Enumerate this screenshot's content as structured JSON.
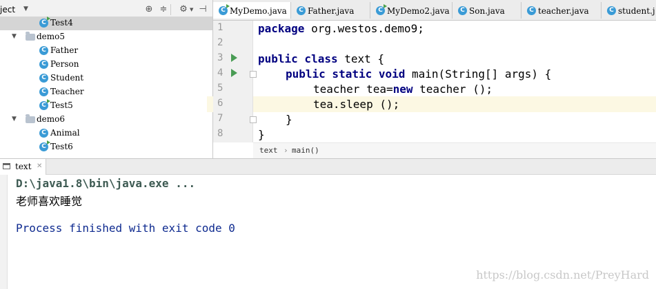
{
  "project_panel": {
    "title": "ject",
    "tree": [
      {
        "label": "Test4",
        "type": "class-run",
        "selected": true
      },
      {
        "label": "demo5",
        "type": "package"
      },
      {
        "label": "Father",
        "type": "class"
      },
      {
        "label": "Person",
        "type": "class"
      },
      {
        "label": "Student",
        "type": "class"
      },
      {
        "label": "Teacher",
        "type": "class"
      },
      {
        "label": "Test5",
        "type": "class-run"
      },
      {
        "label": "demo6",
        "type": "package"
      },
      {
        "label": "Animal",
        "type": "class"
      },
      {
        "label": "Test6",
        "type": "class-run"
      }
    ]
  },
  "editor": {
    "tabs": [
      {
        "label": "MyDemo.java"
      },
      {
        "label": "Father.java"
      },
      {
        "label": "MyDemo2.java"
      },
      {
        "label": "Son.java"
      },
      {
        "label": "teacher.java"
      },
      {
        "label": "student.j"
      }
    ],
    "line_numbers": [
      "1",
      "2",
      "3",
      "4",
      "5",
      "6",
      "7",
      "8"
    ],
    "code": {
      "l1_kw": "package",
      "l1_rest": " org.westos.demo9;",
      "l3_kw": "public class",
      "l3_rest": " text {",
      "l4_kw": "public static void",
      "l4_rest": " main(String[] args) {",
      "l5_a": "teacher tea=",
      "l5_kw": "new",
      "l5_b": " teacher ();",
      "l6": "tea.sleep ();",
      "l7": "}",
      "l8": "}"
    },
    "breadcrumb": [
      "text",
      "main()"
    ],
    "highlight_line": 6
  },
  "run_panel": {
    "tab_label": "text",
    "output": [
      "D:\\java1.8\\bin\\java.exe ...",
      "老师喜欢睡觉",
      "Process finished with exit code 0"
    ]
  },
  "watermark": "https://blog.csdn.net/PreyHard",
  "colors": {
    "keyword": "#000080",
    "console_cmd": "#3d5a52",
    "console_exit": "#0e2a8f",
    "highlight_line": "#fcf8e3",
    "class_icon": "#3a9bd6"
  }
}
